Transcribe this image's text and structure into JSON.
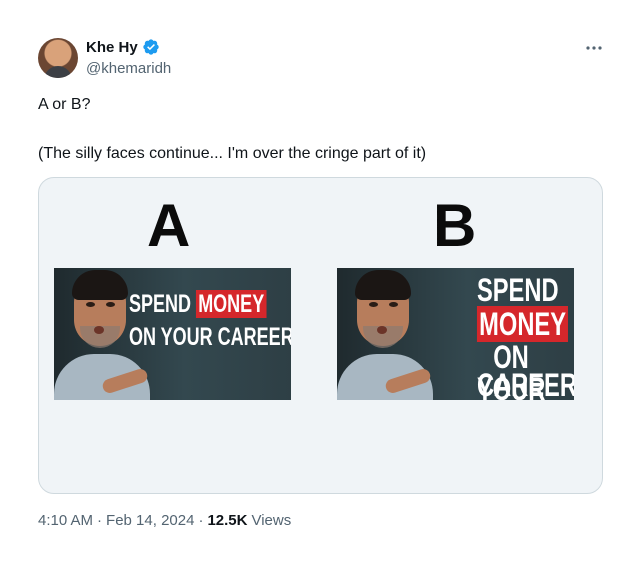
{
  "author": {
    "display_name": "Khe Hy",
    "handle": "@khemaridh",
    "verified": true,
    "verified_color": "#1d9bf0"
  },
  "tweet": {
    "line1": "A or B?",
    "line2": "(The silly faces continue... I'm over the cringe part of it)"
  },
  "media": {
    "option_a": {
      "label": "A",
      "thumbnail_text": {
        "spend": "SPEND",
        "money": "MONEY",
        "line2": "ON YOUR CAREER"
      }
    },
    "option_b": {
      "label": "B",
      "thumbnail_text": {
        "spend": "SPEND",
        "money": "MONEY",
        "on_your": "ON YOUR",
        "career": "CAREER"
      }
    },
    "highlight_color": "#d5272b"
  },
  "footer": {
    "time": "4:10 AM",
    "date": "Feb 14, 2024",
    "views_count": "12.5K",
    "views_label": "Views",
    "separator": "·"
  },
  "icons": {
    "more": "more-horizontal-icon",
    "verified": "verified-badge-icon"
  }
}
